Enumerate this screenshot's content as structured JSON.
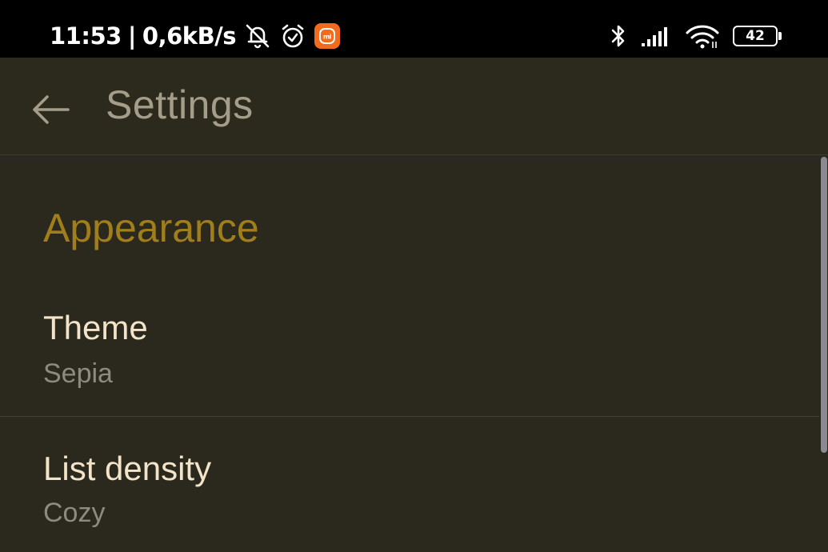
{
  "status_bar": {
    "time": "11:53",
    "separator": "|",
    "speed": "0,6kB/s",
    "battery_level": "42",
    "battery_fraction": 0.42,
    "icons": [
      "bell-off-icon",
      "alarm-icon",
      "mi-app-icon",
      "bluetooth-icon",
      "cell-signal-icon",
      "wifi-icon",
      "battery-icon"
    ]
  },
  "app_bar": {
    "title": "Settings",
    "back_icon": "arrow-back-icon"
  },
  "section": {
    "title": "Appearance"
  },
  "preferences": [
    {
      "title": "Theme",
      "summary": "Sepia"
    },
    {
      "title": "List density",
      "summary": "Cozy"
    }
  ],
  "colors": {
    "background": "#2b291d",
    "accent": "#a17e1c",
    "title_text": "#f3e4c9",
    "summary_text": "#8d8a80",
    "app_bar_text": "#a49d89"
  }
}
